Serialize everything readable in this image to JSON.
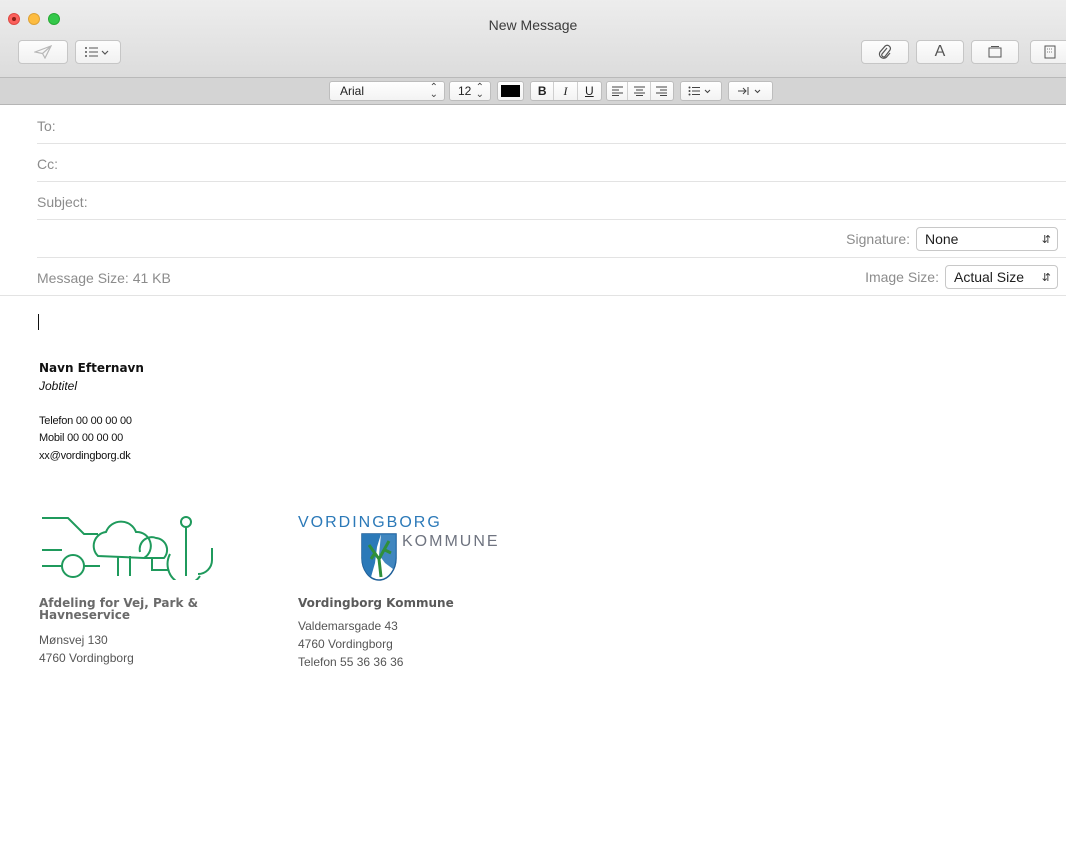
{
  "window": {
    "title": "New Message"
  },
  "toolbar": {
    "font_icon_label": "A"
  },
  "format_bar": {
    "font_family": "Arial",
    "font_size": "12",
    "text_color": "#000000",
    "bold_label": "B",
    "italic_label": "I",
    "underline_label": "U"
  },
  "fields": {
    "to_label": "To:",
    "cc_label": "Cc:",
    "subject_label": "Subject:"
  },
  "signature_row": {
    "label": "Signature:",
    "value": "None"
  },
  "size_row": {
    "message_size_label": "Message Size: 41 KB",
    "image_size_label": "Image Size:",
    "image_size_value": "Actual Size"
  },
  "signature": {
    "name": "Navn Efternavn",
    "job_title": "Jobtitel",
    "phone": "Telefon 00 00 00 00",
    "mobile": "Mobil 00 00 00 00",
    "email": "xx@vordingborg.dk"
  },
  "department": {
    "title": "Afdeling for Vej, Park & Havneservice",
    "address_line1": "Mønsvej 130",
    "address_line2": "4760 Vordingborg"
  },
  "municipality": {
    "logo_line1": "VORDINGBORG",
    "logo_line2": "KOMMUNE",
    "name": "Vordingborg Kommune",
    "address_line1": "Valdemarsgade 43",
    "address_line2": "4760 Vordingborg",
    "phone": "Telefon 55 36 36 36"
  },
  "colors": {
    "dept_logo_green": "#1f9a5c",
    "vk_blue": "#2b79b8",
    "vk_green": "#2f8f3a"
  }
}
